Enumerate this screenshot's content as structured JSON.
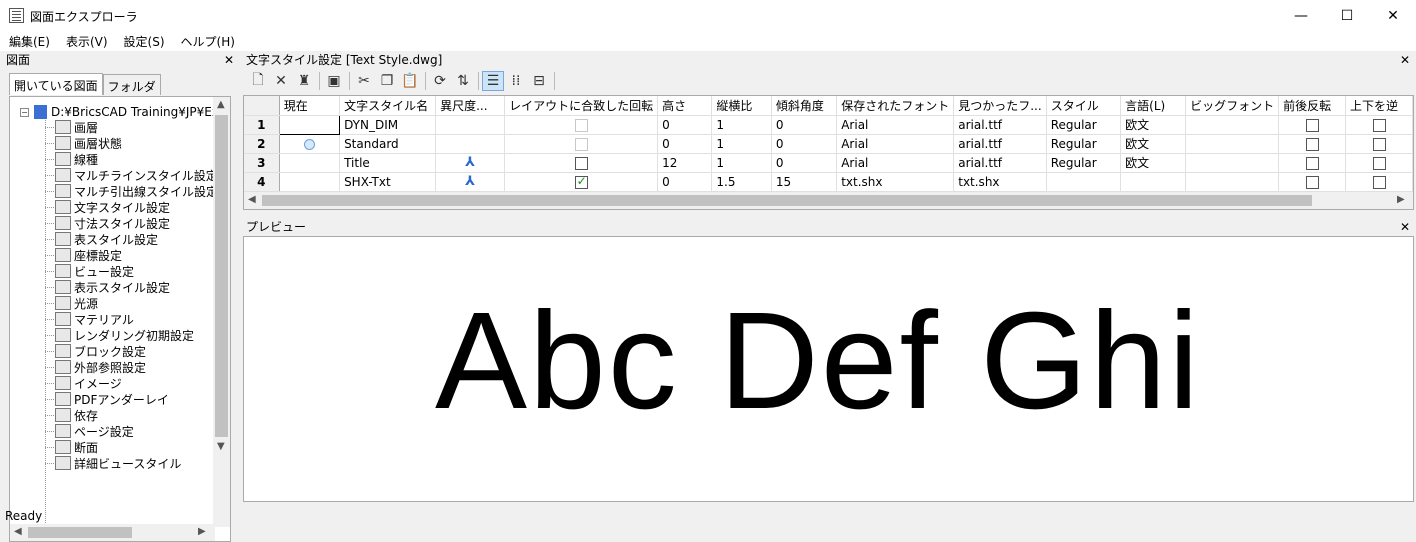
{
  "window": {
    "title": "図面エクスプローラ",
    "min": "—",
    "max": "☐",
    "close": "✕"
  },
  "menu": [
    "編集(E)",
    "表示(V)",
    "設定(S)",
    "ヘルプ(H)"
  ],
  "left_panel": {
    "header": "図面",
    "close": "✕",
    "tabs": [
      "開いている図面",
      "フォルダ"
    ],
    "root": "D:¥BricsCAD Training¥JP¥Ex",
    "items": [
      "画層",
      "画層状態",
      "線種",
      "マルチラインスタイル設定",
      "マルチ引出線スタイル設定",
      "文字スタイル設定",
      "寸法スタイル設定",
      "表スタイル設定",
      "座標設定",
      "ビュー設定",
      "表示スタイル設定",
      "光源",
      "マテリアル",
      "レンダリング初期設定",
      "ブロック設定",
      "外部参照設定",
      "イメージ",
      "PDFアンダーレイ",
      "依存",
      "ページ設定",
      "断面",
      "詳細ビュースタイル"
    ]
  },
  "grid_panel": {
    "header": "文字スタイル設定 [Text Style.dwg]",
    "close": "✕",
    "columns": [
      "",
      "現在",
      "文字スタイル名",
      "異尺度...",
      "レイアウトに合致した回転",
      "高さ",
      "縦横比",
      "傾斜角度",
      "保存されたフォント",
      "見つかったフ...",
      "スタイル",
      "言語(L)",
      "ビッグフォント",
      "前後反転",
      "上下を逆"
    ],
    "rows": [
      {
        "num": "1",
        "name": "DYN_DIM",
        "height": "0",
        "aspect": "1",
        "oblique": "0",
        "saved_font": "Arial",
        "found_font": "arial.ttf",
        "style": "Regular",
        "lang": "欧文"
      },
      {
        "num": "2",
        "name": "Standard",
        "height": "0",
        "aspect": "1",
        "oblique": "0",
        "saved_font": "Arial",
        "found_font": "arial.ttf",
        "style": "Regular",
        "lang": "欧文"
      },
      {
        "num": "3",
        "name": "Title",
        "height": "12",
        "aspect": "1",
        "oblique": "0",
        "saved_font": "Arial",
        "found_font": "arial.ttf",
        "style": "Regular",
        "lang": "欧文"
      },
      {
        "num": "4",
        "name": "SHX-Txt",
        "height": "0",
        "aspect": "1.5",
        "oblique": "15",
        "saved_font": "txt.shx",
        "found_font": "txt.shx",
        "style": "",
        "lang": ""
      }
    ]
  },
  "preview_panel": {
    "header": "プレビュー",
    "close": "✕",
    "sample": "Abc Def Ghi"
  },
  "status": "Ready"
}
